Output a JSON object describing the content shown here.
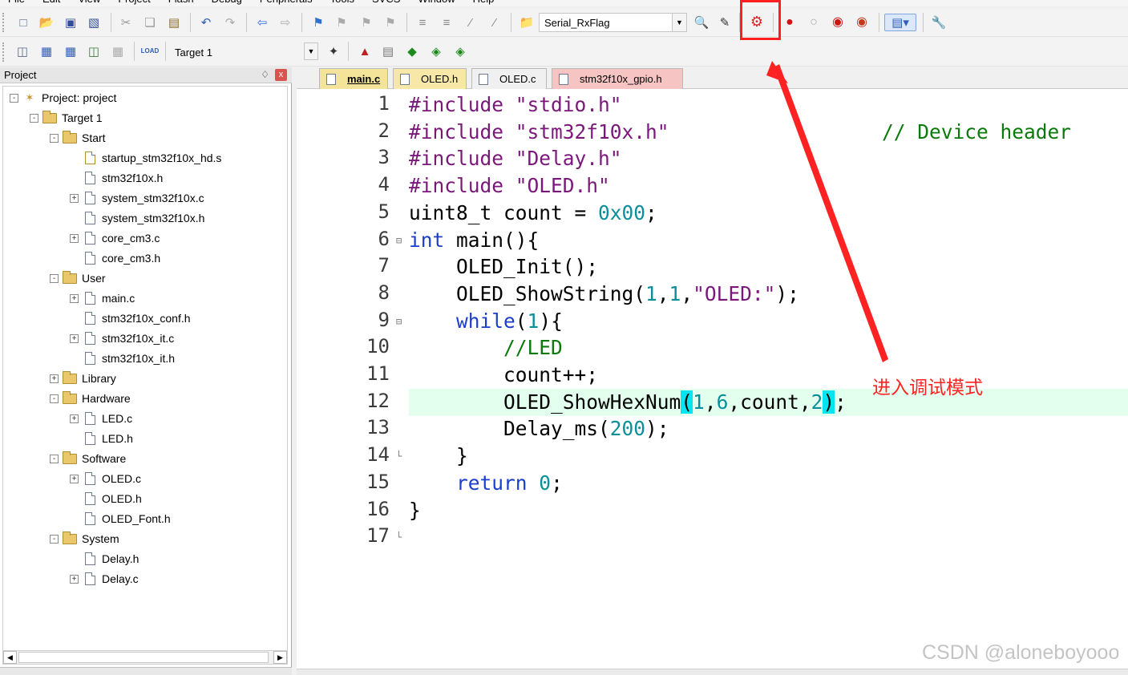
{
  "menu": [
    "File",
    "Edit",
    "View",
    "Project",
    "Flash",
    "Debug",
    "Peripherals",
    "Tools",
    "SVCS",
    "Window",
    "Help"
  ],
  "toolbar1": {
    "target_combo": "Serial_RxFlag",
    "highlighted_button": "start-stop-debug-session",
    "highlight_color": "#ff1f1f"
  },
  "toolbar2": {
    "target_label": "Target 1",
    "load_label": "LOAD"
  },
  "project_panel": {
    "title": "Project",
    "pin_glyph": "❘",
    "close_glyph": "x",
    "root": "Project: project",
    "target": "Target 1",
    "nodes": [
      {
        "label": "Start",
        "kind": "folder",
        "level": 2,
        "expander": "-"
      },
      {
        "label": "startup_stm32f10x_hd.s",
        "kind": "file",
        "level": 3,
        "expander": ""
      },
      {
        "label": "stm32f10x.h",
        "kind": "file",
        "level": 3,
        "expander": ""
      },
      {
        "label": "system_stm32f10x.c",
        "kind": "file",
        "level": 3,
        "expander": "+"
      },
      {
        "label": "system_stm32f10x.h",
        "kind": "file",
        "level": 3,
        "expander": ""
      },
      {
        "label": "core_cm3.c",
        "kind": "file",
        "level": 3,
        "expander": "+"
      },
      {
        "label": "core_cm3.h",
        "kind": "file",
        "level": 3,
        "expander": ""
      },
      {
        "label": "User",
        "kind": "folder",
        "level": 2,
        "expander": "-"
      },
      {
        "label": "main.c",
        "kind": "file",
        "level": 3,
        "expander": "+"
      },
      {
        "label": "stm32f10x_conf.h",
        "kind": "file",
        "level": 3,
        "expander": ""
      },
      {
        "label": "stm32f10x_it.c",
        "kind": "file",
        "level": 3,
        "expander": "+"
      },
      {
        "label": "stm32f10x_it.h",
        "kind": "file",
        "level": 3,
        "expander": ""
      },
      {
        "label": "Library",
        "kind": "folder",
        "level": 2,
        "expander": "+"
      },
      {
        "label": "Hardware",
        "kind": "folder",
        "level": 2,
        "expander": "-"
      },
      {
        "label": "LED.c",
        "kind": "file",
        "level": 3,
        "expander": "+"
      },
      {
        "label": "LED.h",
        "kind": "file",
        "level": 3,
        "expander": ""
      },
      {
        "label": "Software",
        "kind": "folder",
        "level": 2,
        "expander": "-"
      },
      {
        "label": "OLED.c",
        "kind": "file",
        "level": 3,
        "expander": "+"
      },
      {
        "label": "OLED.h",
        "kind": "file",
        "level": 3,
        "expander": ""
      },
      {
        "label": "OLED_Font.h",
        "kind": "file",
        "level": 3,
        "expander": ""
      },
      {
        "label": "System",
        "kind": "folder",
        "level": 2,
        "expander": "-"
      },
      {
        "label": "Delay.h",
        "kind": "file",
        "level": 3,
        "expander": ""
      },
      {
        "label": "Delay.c",
        "kind": "file",
        "level": 3,
        "expander": "+"
      }
    ]
  },
  "editor": {
    "tabs": [
      {
        "label": "main.c",
        "active": true,
        "color": "#f3e49a"
      },
      {
        "label": "OLED.h",
        "active": false,
        "color": "#f7e8a8"
      },
      {
        "label": "OLED.c",
        "active": false,
        "color": "#f0f0f0"
      },
      {
        "label": "stm32f10x_gpio.h",
        "active": false,
        "color": "#f7c4c4"
      }
    ],
    "highlighted_line": 12,
    "lines": [
      [
        {
          "t": "#include",
          "c": "pp"
        },
        {
          "t": " \"stdio.h\"",
          "c": "str"
        }
      ],
      [
        {
          "t": "#include",
          "c": "pp"
        },
        {
          "t": " \"stm32f10x.h\"",
          "c": "str"
        },
        {
          "t": "                  // Device header",
          "c": "cm"
        }
      ],
      [
        {
          "t": "#include",
          "c": "pp"
        },
        {
          "t": " \"Delay.h\"",
          "c": "str"
        }
      ],
      [
        {
          "t": "#include",
          "c": "pp"
        },
        {
          "t": " \"OLED.h\"",
          "c": "str"
        }
      ],
      [
        {
          "t": "uint8_t count = "
        },
        {
          "t": "0x00",
          "c": "num"
        },
        {
          "t": ";"
        }
      ],
      [
        {
          "t": "int",
          "c": "kw"
        },
        {
          "t": " main(){"
        }
      ],
      [
        {
          "t": "    OLED_Init();"
        }
      ],
      [
        {
          "t": "    OLED_ShowString("
        },
        {
          "t": "1",
          "c": "num"
        },
        {
          "t": ","
        },
        {
          "t": "1",
          "c": "num"
        },
        {
          "t": ","
        },
        {
          "t": "\"OLED:\"",
          "c": "str"
        },
        {
          "t": ");"
        }
      ],
      [
        {
          "t": "    "
        },
        {
          "t": "while",
          "c": "kw"
        },
        {
          "t": "("
        },
        {
          "t": "1",
          "c": "num"
        },
        {
          "t": "){"
        }
      ],
      [
        {
          "t": "        "
        },
        {
          "t": "//LED",
          "c": "cm"
        }
      ],
      [
        {
          "t": "        count++;"
        }
      ],
      [
        {
          "t": "        OLED_ShowHexNum"
        },
        {
          "t": "(",
          "c": "br"
        },
        {
          "t": "1",
          "c": "num"
        },
        {
          "t": ","
        },
        {
          "t": "6",
          "c": "num"
        },
        {
          "t": ",count,"
        },
        {
          "t": "2",
          "c": "num"
        },
        {
          "t": ")",
          "c": "br"
        },
        {
          "t": ";"
        }
      ],
      [
        {
          "t": "        Delay_ms("
        },
        {
          "t": "200",
          "c": "num"
        },
        {
          "t": ");"
        }
      ],
      [
        {
          "t": "    }"
        }
      ],
      [
        {
          "t": "    "
        },
        {
          "t": "return",
          "c": "kw"
        },
        {
          "t": " "
        },
        {
          "t": "0",
          "c": "num"
        },
        {
          "t": ";"
        }
      ],
      [
        {
          "t": "}"
        }
      ],
      []
    ],
    "fold_markers": {
      "6": "minus",
      "9": "minus",
      "14": "end",
      "17": "end"
    }
  },
  "annotation": {
    "text": "进入调试模式",
    "color": "#ff2222"
  },
  "watermark": "CSDN @aloneboyooo"
}
